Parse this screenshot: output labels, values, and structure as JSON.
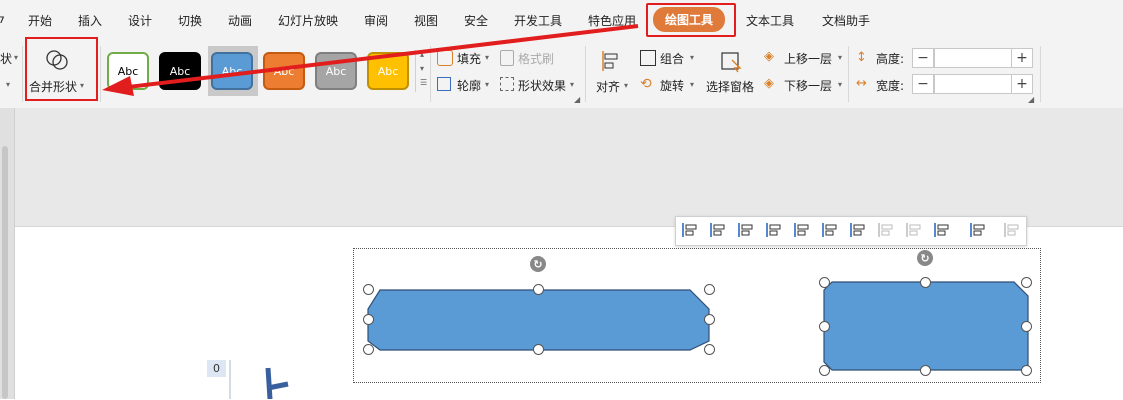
{
  "menu": {
    "partial_left": "ל",
    "items": [
      "开始",
      "插入",
      "设计",
      "切换",
      "动画",
      "幻灯片放映",
      "审阅",
      "视图",
      "安全",
      "开发工具",
      "特色应用"
    ],
    "active": "绘图工具",
    "after": [
      "文本工具",
      "文档助手"
    ]
  },
  "ribbon": {
    "partial_left_top": "状",
    "merge_shapes_label": "合并形状",
    "style_label": "Abc",
    "styles": [
      {
        "bg": "#ffffff",
        "border": "#70ad47",
        "text": "#000000"
      },
      {
        "bg": "#000000",
        "border": "#000000",
        "text": "#ffffff"
      },
      {
        "bg": "#5b9bd5",
        "border": "#41719c",
        "text": "#ffffff"
      },
      {
        "bg": "#ed7d31",
        "border": "#c55a11",
        "text": "#ffffff"
      },
      {
        "bg": "#a5a5a5",
        "border": "#7f7f7f",
        "text": "#ffffff"
      },
      {
        "bg": "#ffc000",
        "border": "#bf9000",
        "text": "#ffffff"
      }
    ],
    "fill_label": "填充",
    "format_brush_label": "格式刷",
    "outline_label": "轮廓",
    "shape_effects_label": "形状效果",
    "align_label": "对齐",
    "group_label": "组合",
    "rotate_label": "旋转",
    "selection_pane_label": "选择窗格",
    "bring_forward_label": "上移一层",
    "send_backward_label": "下移一层",
    "height_label": "高度:",
    "width_label": "宽度:",
    "minus": "−",
    "plus": "+"
  },
  "slide": {
    "ruler_marker": "0",
    "accent": "#e21d1d",
    "shape_fill": "#5b9bd5"
  }
}
